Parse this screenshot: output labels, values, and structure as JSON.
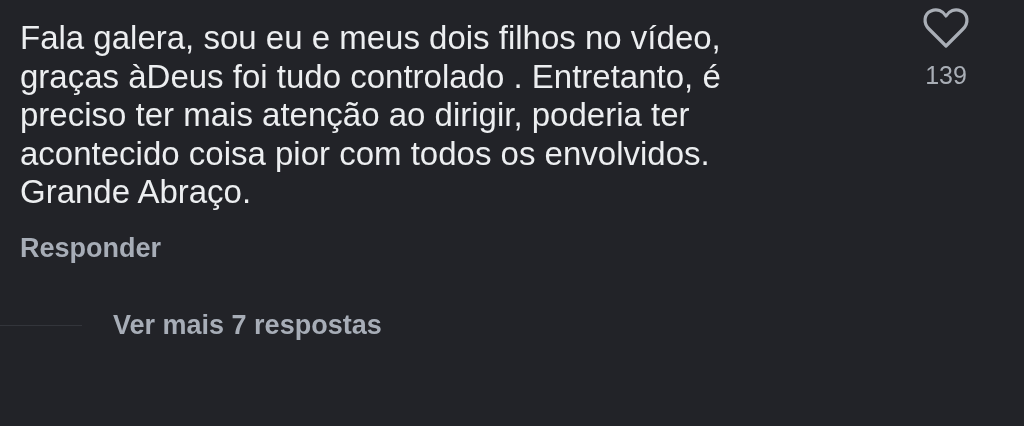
{
  "comment": {
    "text": "Fala galera, sou eu e meus dois filhos no vídeo, graças àDeus foi tudo controlado . Entretanto, é preciso ter mais atenção ao dirigir, poderia ter acontecido coisa pior com todos os envolvidos.  Grande Abraço.",
    "likes": "139",
    "reply_label": "Responder"
  },
  "more_replies": "Ver mais 7 respostas"
}
